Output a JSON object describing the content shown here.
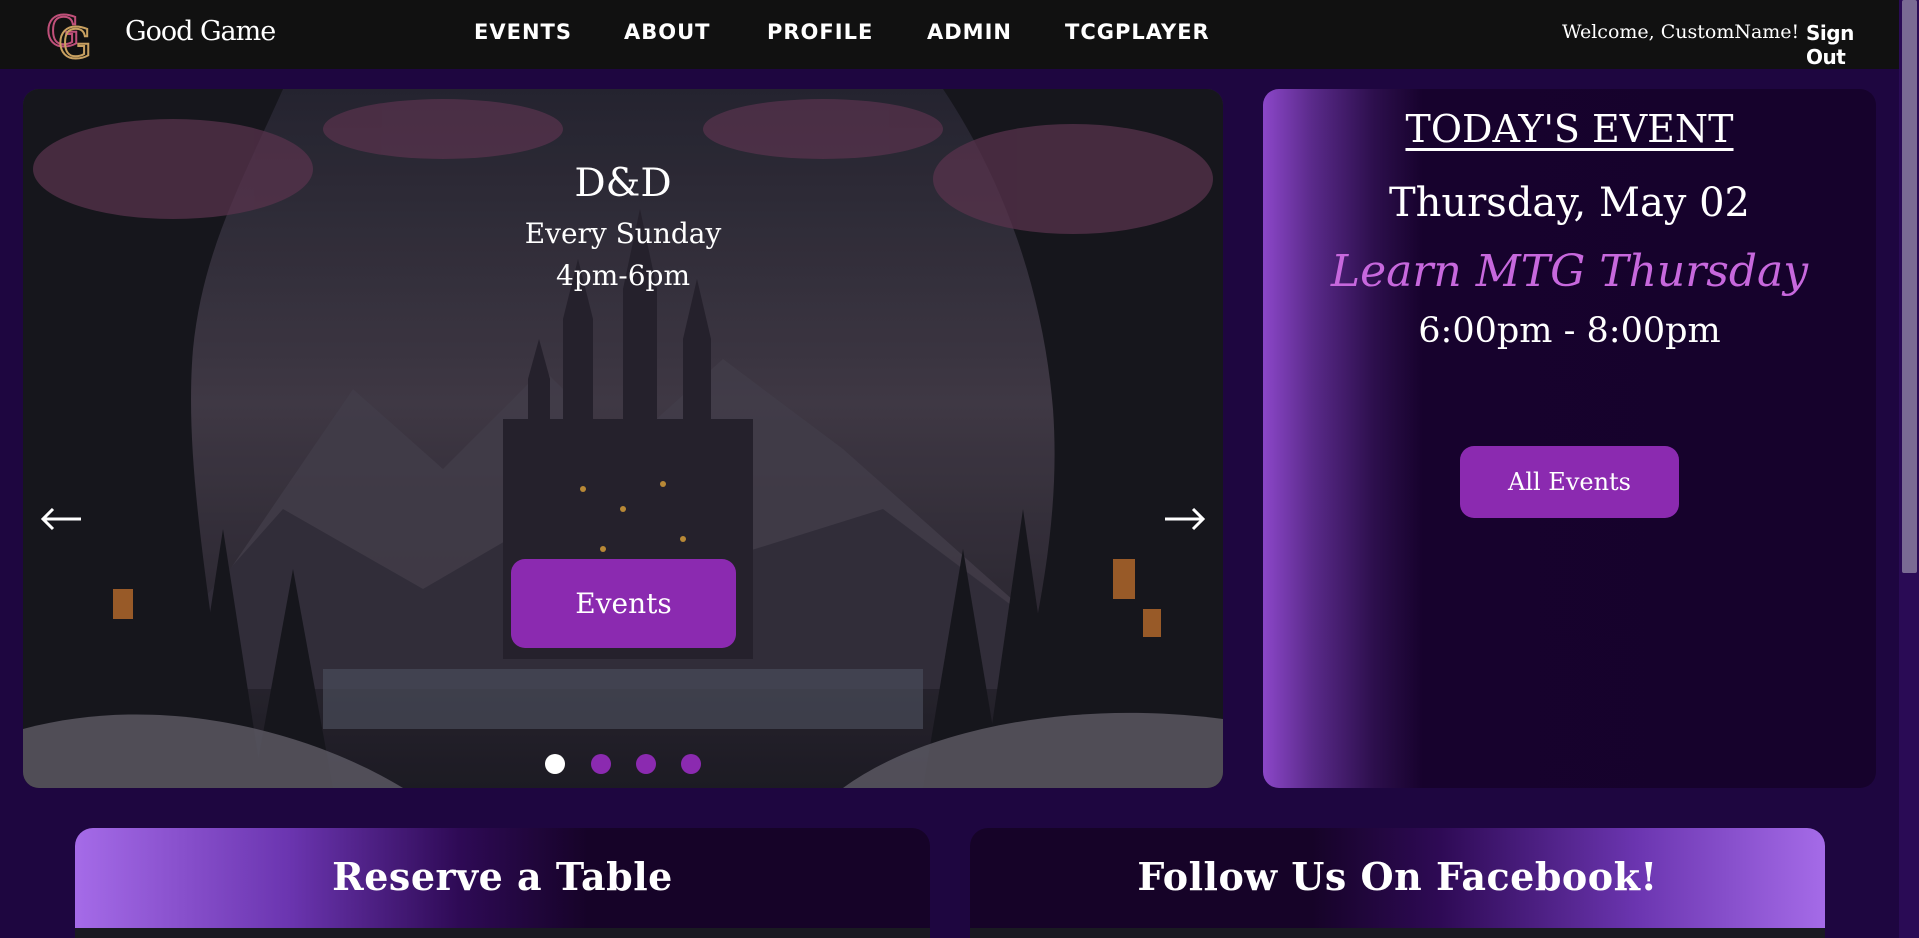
{
  "nav": {
    "brand": "Good Game",
    "links": [
      "EVENTS",
      "ABOUT",
      "PROFILE",
      "ADMIN",
      "TCGPLAYER"
    ],
    "welcome": "Welcome, CustomName!",
    "signout": "Sign Out"
  },
  "carousel": {
    "title": "D&D",
    "subtitle": "Every Sunday",
    "time": "4pm-6pm",
    "button": "Events",
    "slide_count": 4,
    "active_slide": 1
  },
  "today": {
    "heading": "TODAY'S EVENT",
    "date": "Thursday, May 02",
    "event_name": "Learn MTG Thursday",
    "time": "6:00pm - 8:00pm",
    "button": "All Events"
  },
  "cards": {
    "reserve_title": "Reserve a Table",
    "facebook_title": "Follow Us On Facebook!"
  },
  "colors": {
    "accent": "#8b2ab0",
    "event_name": "#c768dd",
    "background": "#1e0640",
    "nav": "#111111"
  },
  "icons": {
    "logo": "gg-monogram-icon",
    "prev": "arrow-left-icon",
    "next": "arrow-right-icon"
  }
}
